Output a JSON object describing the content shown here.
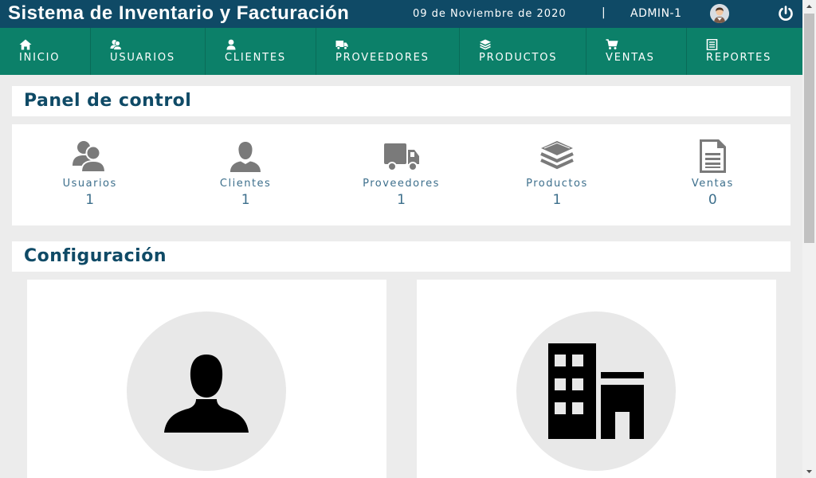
{
  "header": {
    "title": "Sistema de Inventario y Facturación",
    "date": "09 de Noviembre de 2020",
    "separator": "|",
    "user": "ADMIN-1",
    "avatar_icon": "user-avatar-icon",
    "power_icon": "power-icon"
  },
  "nav": [
    {
      "label": "INICIO",
      "icon": "home-icon"
    },
    {
      "label": "USUARIOS",
      "icon": "users-icon"
    },
    {
      "label": "CLIENTES",
      "icon": "user-icon"
    },
    {
      "label": "PROVEEDORES",
      "icon": "truck-icon"
    },
    {
      "label": "PRODUCTOS",
      "icon": "layers-icon"
    },
    {
      "label": "VENTAS",
      "icon": "cart-icon"
    },
    {
      "label": "REPORTES",
      "icon": "report-icon"
    }
  ],
  "dashboard": {
    "title": "Panel de control",
    "stats": [
      {
        "label": "Usuarios",
        "value": "1",
        "icon": "users-icon"
      },
      {
        "label": "Clientes",
        "value": "1",
        "icon": "user-icon"
      },
      {
        "label": "Proveedores",
        "value": "1",
        "icon": "truck-icon"
      },
      {
        "label": "Productos",
        "value": "1",
        "icon": "layers-icon"
      },
      {
        "label": "Ventas",
        "value": "0",
        "icon": "document-icon"
      }
    ]
  },
  "config": {
    "title": "Configuración",
    "cards": [
      {
        "icon": "user-profile-icon"
      },
      {
        "icon": "building-icon"
      }
    ]
  },
  "colors": {
    "header_bg": "#0f4a66",
    "nav_bg": "#0c8069",
    "accent_text": "#3d6f8c",
    "icon_gray": "#7a7a7a"
  }
}
